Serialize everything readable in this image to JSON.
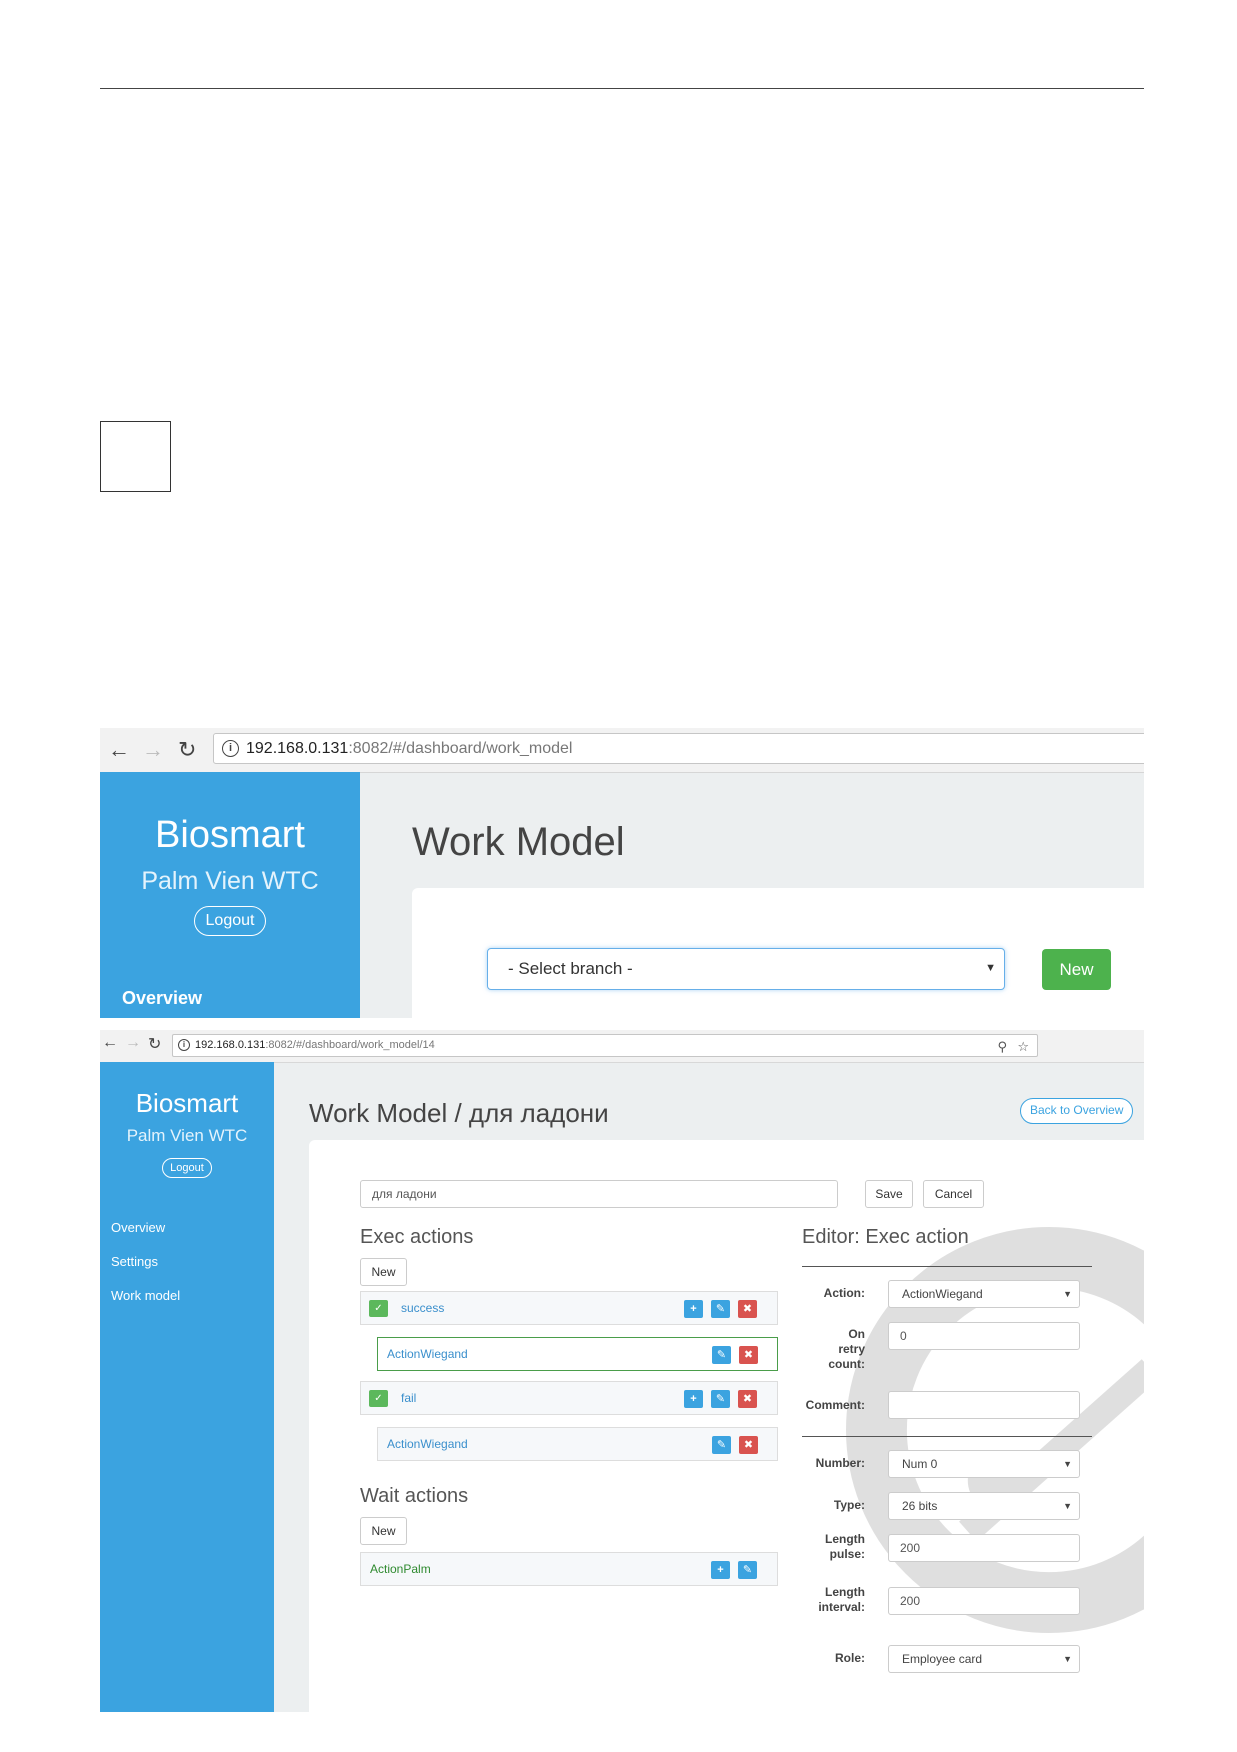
{
  "screen1": {
    "url": {
      "host": "192.168.0.131",
      "path": ":8082/#/dashboard/work_model"
    },
    "sidebar": {
      "brand": "Biosmart",
      "subtitle": "Palm Vien WTC",
      "logout": "Logout",
      "nav": [
        "Overview"
      ]
    },
    "page_title": "Work Model",
    "branch_select": {
      "value": "- Select branch -"
    },
    "new_button": "New",
    "colors": {
      "sidebar": "#3ba3e0",
      "new_button": "#4db24d"
    }
  },
  "screen2": {
    "url": {
      "host": "192.168.0.131",
      "path": ":8082/#/dashboard/work_model/14"
    },
    "sidebar": {
      "brand": "Biosmart",
      "subtitle": "Palm Vien WTC",
      "logout": "Logout",
      "nav": [
        "Overview",
        "Settings",
        "Work model"
      ]
    },
    "page_title": "Work Model / для ладони",
    "back_button": "Back to Overview",
    "name_input": {
      "value": "для ладони"
    },
    "save_button": "Save",
    "cancel_button": "Cancel",
    "exec_actions": {
      "heading": "Exec actions",
      "new_button": "New",
      "groups": [
        {
          "label": "success",
          "children": [
            "ActionWiegand"
          ]
        },
        {
          "label": "fail",
          "children": [
            "ActionWiegand"
          ]
        }
      ]
    },
    "wait_actions": {
      "heading": "Wait actions",
      "new_button": "New",
      "items": [
        "ActionPalm"
      ]
    },
    "editor": {
      "heading": "Editor: Exec action",
      "fields": {
        "action": {
          "label": "Action:",
          "value": "ActionWiegand"
        },
        "retry": {
          "label": [
            "On",
            "retry",
            "count:"
          ],
          "value": "0"
        },
        "comment": {
          "label": "Comment:",
          "value": ""
        },
        "number": {
          "label": "Number:",
          "value": "Num 0"
        },
        "type": {
          "label": "Type:",
          "value": "26 bits"
        },
        "length_pulse": {
          "label": [
            "Length",
            "pulse:"
          ],
          "value": "200"
        },
        "length_interval": {
          "label": [
            "Length",
            "interval:"
          ],
          "value": "200"
        },
        "role": {
          "label": "Role:",
          "value": "Employee card"
        }
      }
    },
    "icons": [
      "back-arrow-icon",
      "forward-arrow-icon",
      "reload-icon",
      "info-icon",
      "key-icon",
      "star-icon",
      "chevron-down-icon",
      "plus-icon",
      "edit-icon",
      "delete-icon"
    ]
  }
}
